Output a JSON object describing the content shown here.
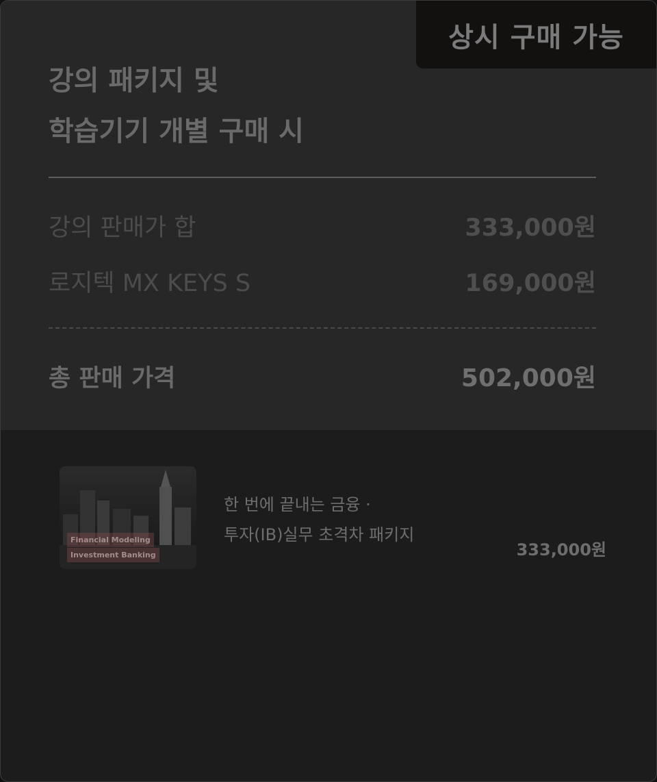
{
  "badge": {
    "label": "상시 구매 가능"
  },
  "header": {
    "title_line1": "강의 패키지 및",
    "title_line2": "학습기기 개별 구매 시"
  },
  "price_rows": [
    {
      "label": "강의 판매가 합",
      "value": "333,000원"
    },
    {
      "label": "로지텍 MX KEYS S",
      "value": "169,000원"
    }
  ],
  "total": {
    "label": "총 판매 가격",
    "value": "502,000원"
  },
  "product": {
    "thumbnail_tag1": "Financial Modeling",
    "thumbnail_tag2": "Investment Banking",
    "title_line1": "한 번에 끝내는 금융 ·",
    "title_line2": "투자(IB)실무 초격차 패키지",
    "price": "333,000원"
  },
  "colors": {
    "card_top": "#272727",
    "card_bottom": "#1c1c1c",
    "badge_bg": "#131110"
  }
}
